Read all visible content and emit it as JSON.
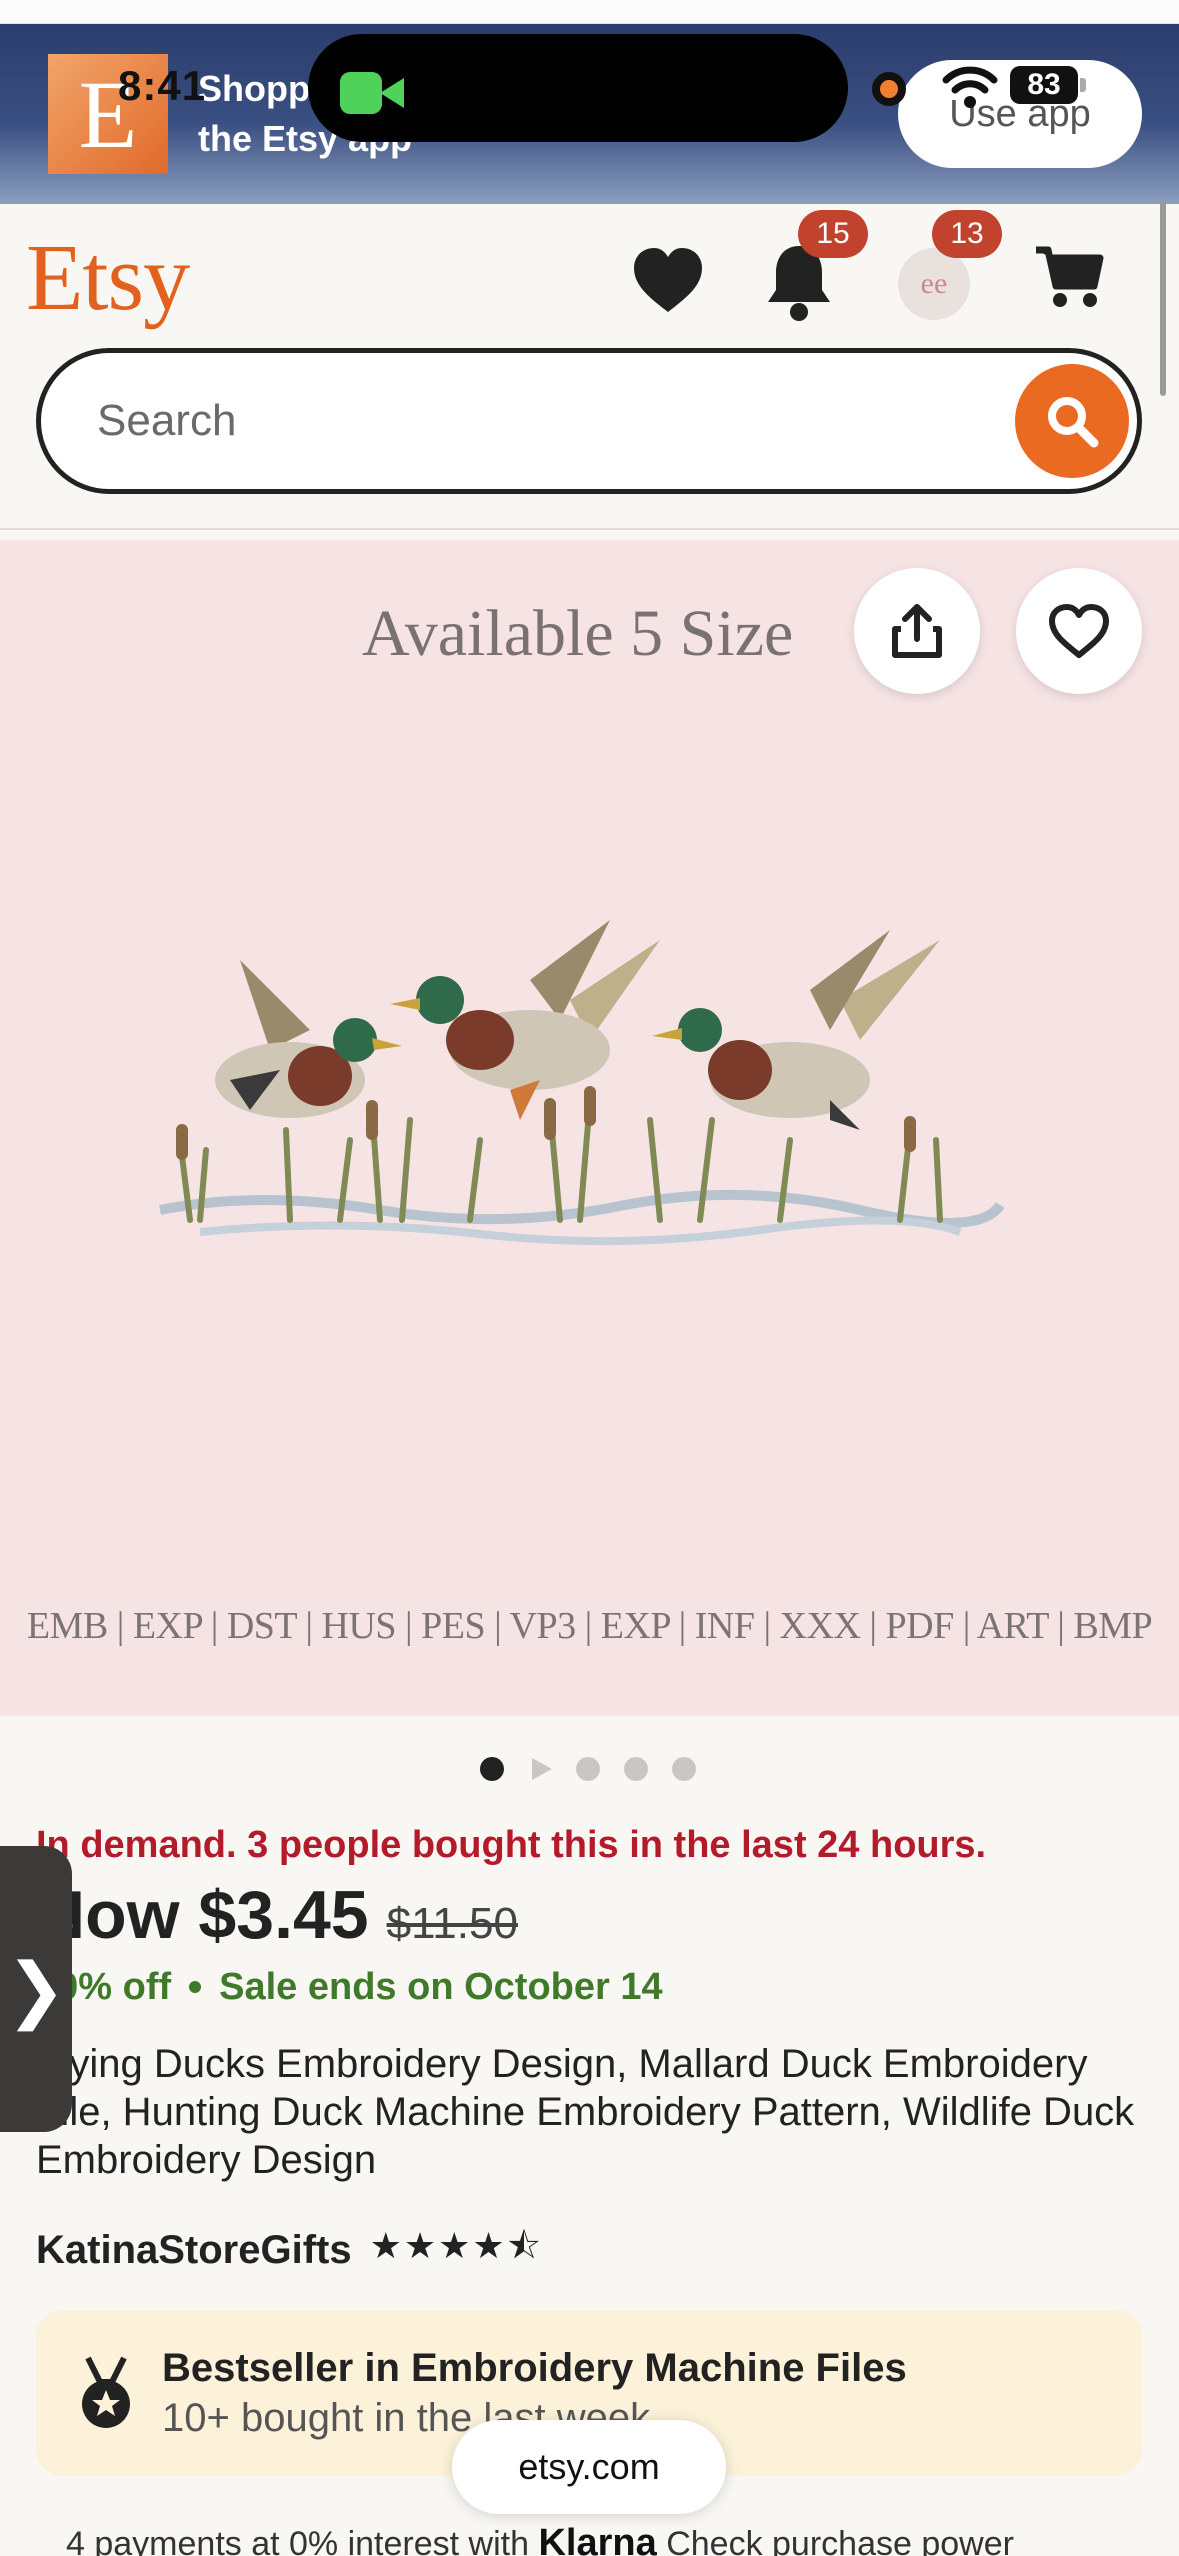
{
  "status_bar": {
    "time": "8:41",
    "battery": "83"
  },
  "app_banner": {
    "line1": "Shopping is better on",
    "line2": "the Etsy app",
    "logo_letter": "E",
    "use_app": "Use app"
  },
  "header": {
    "logo": "Etsy",
    "notifications_count": "15",
    "account_count": "13",
    "avatar_text": "ee",
    "search_placeholder": "Search"
  },
  "product_image": {
    "title": "Available 5 Size",
    "formats": "EMB | EXP | DST | HUS | PES | VP3 | EXP | INF | XXX | PDF | ART | BMP",
    "carousel_count": 5,
    "active_index": 0
  },
  "listing": {
    "in_demand": "In demand. 3 people bought this in the last 24 hours.",
    "price": "Now $3.45",
    "old_price": "$11.50",
    "discount": "70% off",
    "sale_ends": "Sale ends on October 14",
    "title": "Flying Ducks Embroidery Design, Mallard Duck Embroidery File, Hunting Duck Machine Embroidery Pattern, Wildlife Duck Embroidery Design",
    "shop_name": "KatinaStoreGifts",
    "rating": 4.5,
    "stars_text": "★★★★⯪"
  },
  "side_tab": {
    "glyph": "❯"
  },
  "bestseller": {
    "title": "Bestseller in Embroidery Machine Files",
    "subtitle": "10+ bought in the last week"
  },
  "browser": {
    "url": "etsy.com"
  },
  "klarna": {
    "prefix": "4 payments at 0% interest with",
    "brand": "Klarna",
    "suffix": "Check purchase power"
  },
  "colors": {
    "brand_orange": "#e2611c",
    "sale_green": "#3f7a2a",
    "demand_red": "#b31b2b",
    "badge": "#c1432d"
  }
}
